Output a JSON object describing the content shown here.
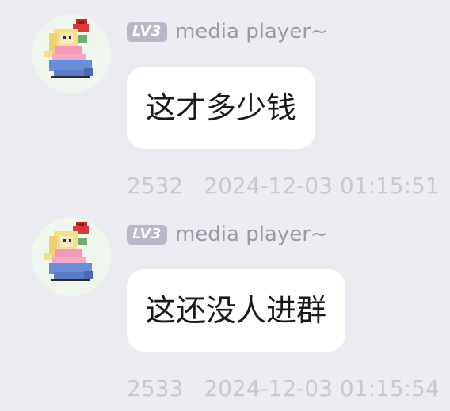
{
  "messages": [
    {
      "level_badge": "LV3",
      "username": "media player~",
      "text": "这才多少钱",
      "message_id": "2532",
      "timestamp": "2024-12-03 01:15:51"
    },
    {
      "level_badge": "LV3",
      "username": "media player~",
      "text": "这还没人进群",
      "message_id": "2533",
      "timestamp": "2024-12-03 01:15:54"
    }
  ],
  "colors": {
    "background": "#ecebf1",
    "bubble": "#ffffff",
    "badge": "#b8b8c8",
    "username": "#9b9ba6",
    "meta": "#c8c8d0"
  }
}
